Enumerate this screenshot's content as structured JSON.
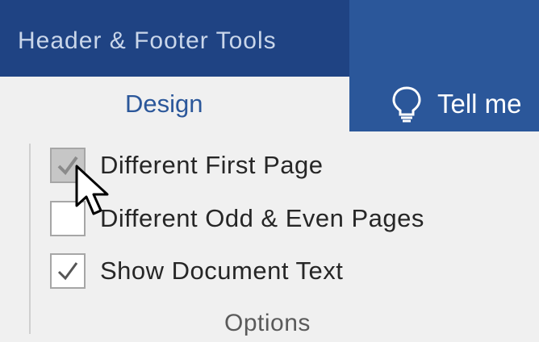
{
  "ribbon": {
    "context_title": "Header & Footer Tools",
    "active_tab": "Design",
    "tell_me_label": "Tell me"
  },
  "options_group": {
    "items": [
      {
        "label": "Different First Page",
        "checked": true,
        "state": "checked-disabled"
      },
      {
        "label": "Different Odd & Even Pages",
        "checked": false
      },
      {
        "label": "Show Document Text",
        "checked": true
      }
    ],
    "group_label": "Options"
  },
  "colors": {
    "ribbon_blue": "#2b579a",
    "context_header_blue": "#1f4383",
    "panel_background": "#f0f0f0"
  }
}
